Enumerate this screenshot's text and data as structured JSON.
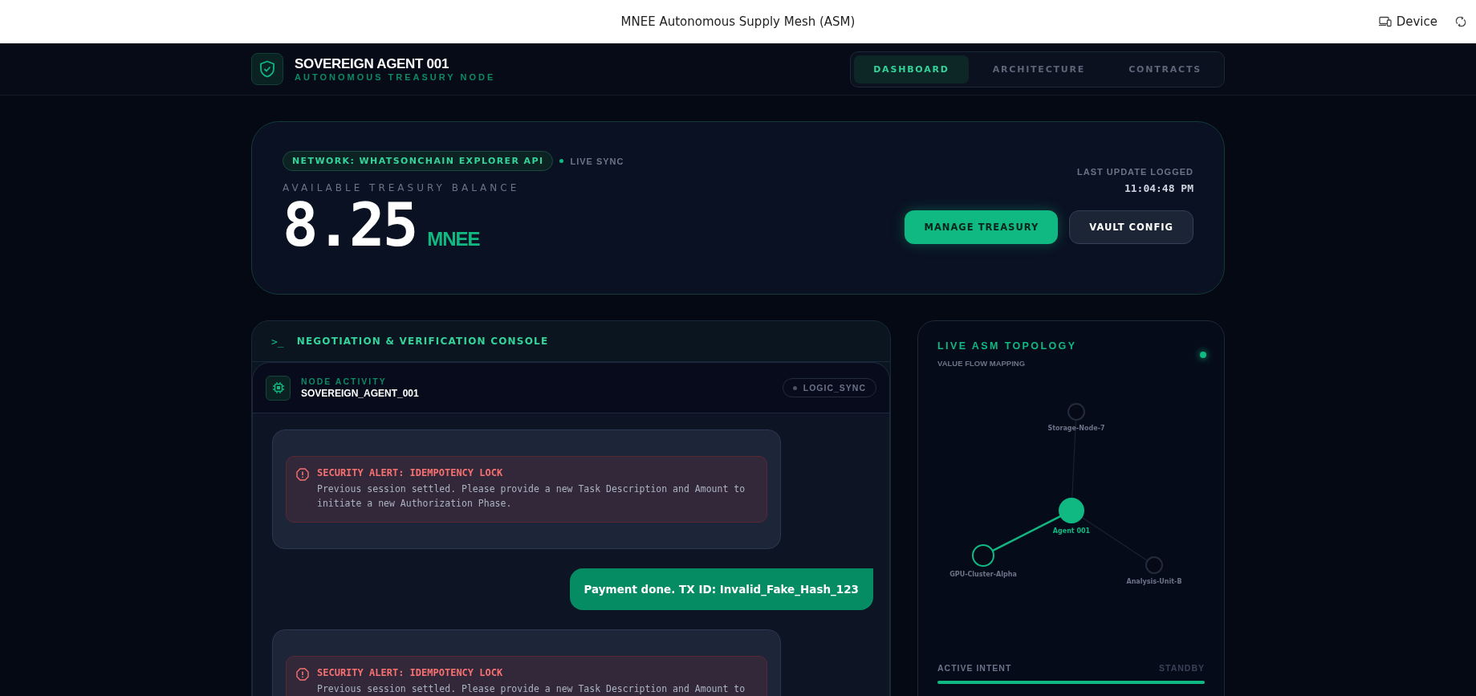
{
  "browser_bar": {
    "title": "MNEE Autonomous Supply Mesh (ASM)",
    "device_label": "Device"
  },
  "header": {
    "title": "SOVEREIGN AGENT 001",
    "subtitle": "AUTONOMOUS TREASURY NODE",
    "tabs": [
      {
        "label": "DASHBOARD",
        "selected": true
      },
      {
        "label": "ARCHITECTURE",
        "selected": false
      },
      {
        "label": "CONTRACTS",
        "selected": false
      }
    ]
  },
  "treasury": {
    "network_badge": "NETWORK: WHATSONCHAIN EXPLORER API",
    "sync": {
      "label": "LIVE SYNC",
      "on": true
    },
    "balance_label": "AVAILABLE TREASURY BALANCE",
    "balance": "8.25",
    "currency": "MNEE",
    "last_update_label": "LAST UPDATE LOGGED",
    "last_update_time": "11:04:48 PM",
    "buttons": [
      {
        "label": "MANAGE TREASURY",
        "kind": "primary"
      },
      {
        "label": "VAULT CONFIG",
        "kind": "secondary"
      }
    ]
  },
  "console": {
    "prompt": ">_",
    "title": "NEGOTIATION & VERIFICATION CONSOLE",
    "node_label": "NODE ACTIVITY",
    "node_name": "SOVEREIGN_AGENT_001",
    "status": {
      "label": "LOGIC_SYNC",
      "on": false
    },
    "messages": [
      {
        "kind": "alert",
        "title": "SECURITY ALERT: IDEMPOTENCY LOCK",
        "text": "Previous session settled. Please provide a new Task Description and Amount to initiate a new Authorization Phase."
      },
      {
        "kind": "user",
        "text": "Payment done. TX ID: Invalid_Fake_Hash_123"
      },
      {
        "kind": "alert",
        "title": "SECURITY ALERT: IDEMPOTENCY LOCK",
        "text": "Previous session settled. Please provide a new Task Description and Amount to"
      }
    ]
  },
  "topology": {
    "title": "LIVE ASM TOPOLOGY",
    "subtitle": "VALUE FLOW MAPPING",
    "live": true,
    "nodes": [
      {
        "label": "Storage-Node-7",
        "kind": "peer",
        "active": false
      },
      {
        "label": "Agent 001",
        "kind": "center",
        "active": true
      },
      {
        "label": "GPU-Cluster-Alpha",
        "kind": "peer",
        "active": true
      },
      {
        "label": "Analysis-Unit-B",
        "kind": "peer",
        "active": false
      }
    ],
    "intent_label": "ACTIVE INTENT",
    "intent_state": "STANDBY",
    "level": 1
  }
}
